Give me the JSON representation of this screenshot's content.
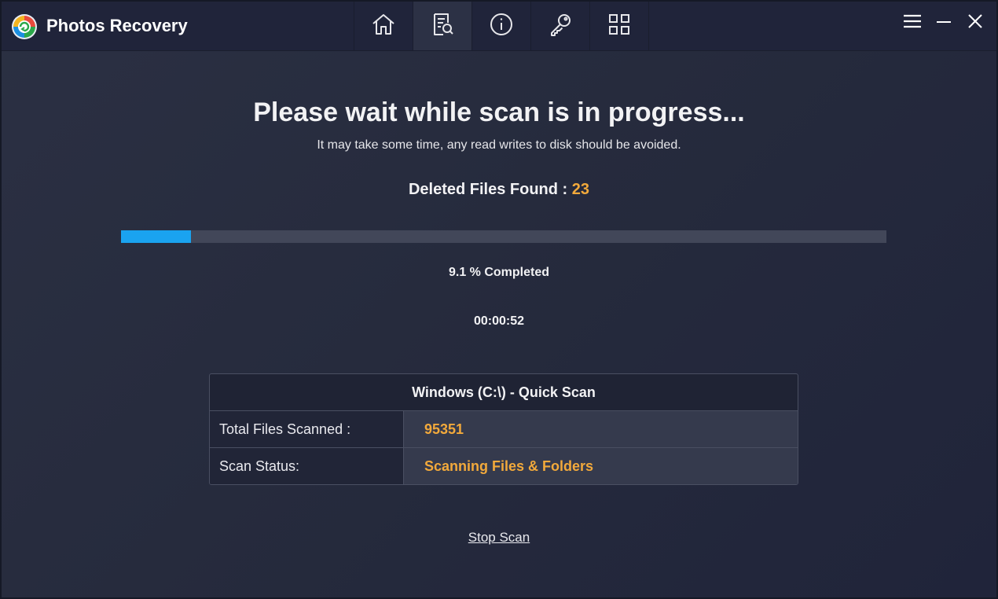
{
  "app": {
    "title": "Photos Recovery"
  },
  "nav": {
    "tabs": [
      {
        "icon": "home-icon"
      },
      {
        "icon": "scan-document-icon",
        "active": true
      },
      {
        "icon": "info-icon"
      },
      {
        "icon": "key-icon"
      },
      {
        "icon": "grid-apps-icon"
      }
    ]
  },
  "window_controls": {
    "menu_icon": "hamburger-menu-icon",
    "minimize_icon": "minimize-icon",
    "close_icon": "close-icon"
  },
  "scan": {
    "headline": "Please wait while scan is in progress...",
    "subline": "It may take some time, any read writes to disk should be avoided.",
    "found_label": "Deleted Files Found :",
    "found_count": "23",
    "progress_percent": 9.1,
    "completed_text": "9.1 % Completed",
    "elapsed": "00:00:52"
  },
  "details": {
    "title": "Windows (C:\\) - Quick Scan",
    "rows": [
      {
        "label": "Total Files Scanned :",
        "value": "95351"
      },
      {
        "label": "Scan Status:",
        "value": "Scanning Files & Folders"
      }
    ]
  },
  "actions": {
    "stop_label": "Stop Scan"
  },
  "colors": {
    "accent_orange": "#f2a93b",
    "progress_blue": "#1aa3f0",
    "background": "#262b3d"
  }
}
